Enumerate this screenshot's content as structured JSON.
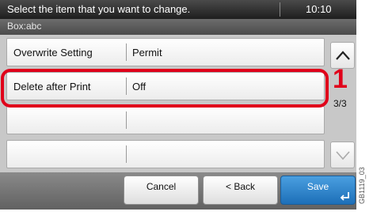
{
  "header": {
    "title": "Select the item that you want to change.",
    "time": "10:10"
  },
  "subheader": {
    "box_name": "Box:abc"
  },
  "rows": [
    {
      "name": "Overwrite Setting",
      "value": "Permit"
    },
    {
      "name": "Delete after Print",
      "value": "Off"
    },
    {
      "name": "",
      "value": ""
    },
    {
      "name": "",
      "value": ""
    }
  ],
  "scroll": {
    "up_icon": "chevron-up-icon",
    "down_icon": "chevron-down-icon",
    "page_indicator": "3/3"
  },
  "callout": {
    "number": "1",
    "color": "#e0001a"
  },
  "footer": {
    "cancel_label": "Cancel",
    "back_label": "< Back",
    "save_label": "Save",
    "save_color": "#1d6fb8"
  },
  "ref_code": "GB1119_03"
}
